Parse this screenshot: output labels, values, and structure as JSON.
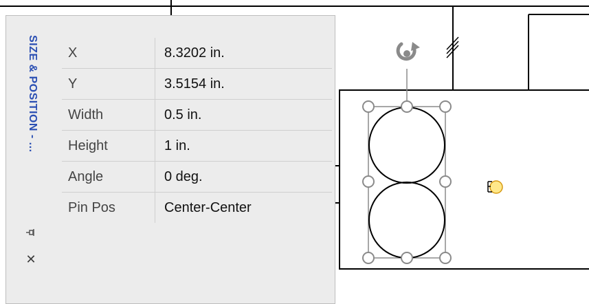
{
  "panel": {
    "title": "SIZE & POSITION - ...",
    "rows": [
      {
        "label": "X",
        "value": "8.3202 in."
      },
      {
        "label": "Y",
        "value": "3.5154 in."
      },
      {
        "label": "Width",
        "value": "0.5 in."
      },
      {
        "label": "Height",
        "value": "1 in."
      },
      {
        "label": "Angle",
        "value": "0 deg."
      },
      {
        "label": "Pin Pos",
        "value": "Center-Center"
      }
    ],
    "icons": {
      "pin": "pin-icon",
      "close": "close-icon"
    }
  },
  "canvas": {
    "icons": {
      "rotate": "rotation-handle-icon",
      "connection": "connection-point-icon"
    },
    "colors": {
      "handle_fill": "#ffe88a",
      "handle_stroke": "#d79a12",
      "selection": "#8a8a8a"
    }
  }
}
